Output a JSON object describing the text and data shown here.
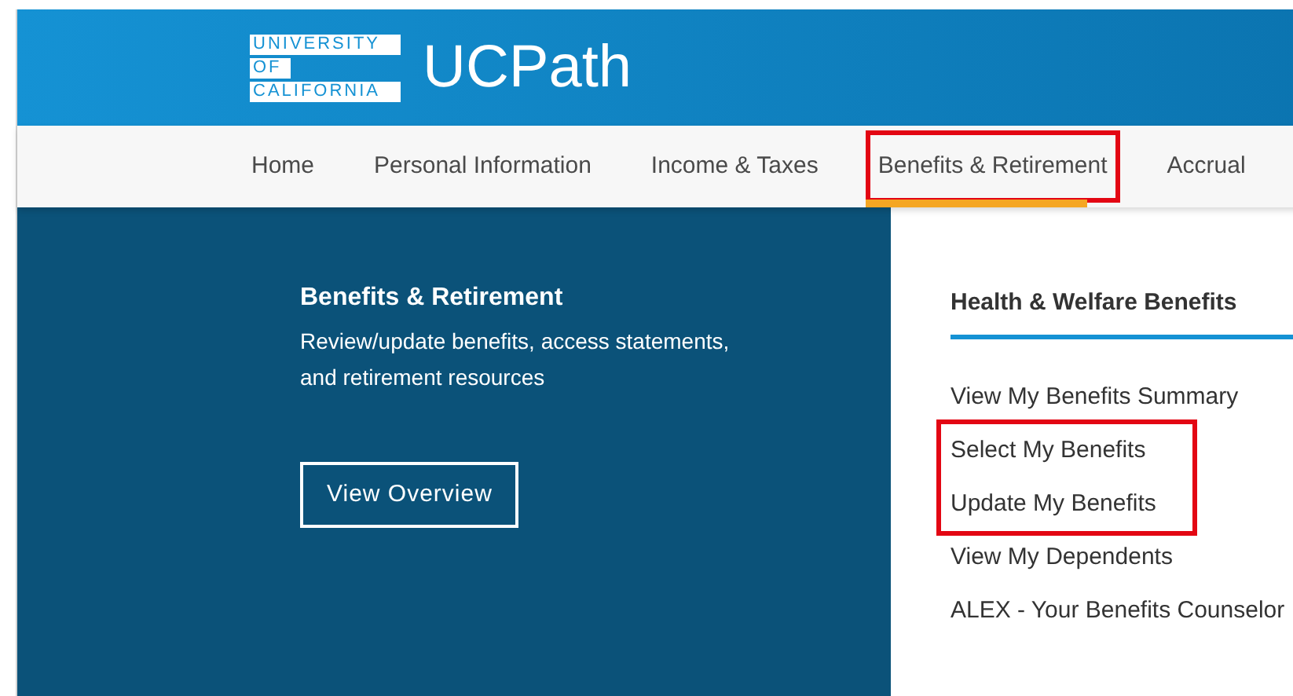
{
  "header": {
    "logo_lines": [
      "UNIVERSITY",
      "OF",
      "CALIFORNIA"
    ],
    "title": "UCPath"
  },
  "nav": [
    {
      "label": "Home",
      "selected": false,
      "highlighted": false
    },
    {
      "label": "Personal Information",
      "selected": false,
      "highlighted": false
    },
    {
      "label": "Income & Taxes",
      "selected": false,
      "highlighted": false
    },
    {
      "label": "Benefits & Retirement",
      "selected": true,
      "highlighted": true
    },
    {
      "label": "Accrual",
      "selected": false,
      "highlighted": false
    }
  ],
  "hero": {
    "title": "Benefits & Retirement",
    "description": "Review/update benefits, access statements, and retirement resources",
    "button": "View Overview"
  },
  "section": {
    "heading": "Health & Welfare Benefits",
    "links": [
      {
        "label": "View My Benefits Summary",
        "highlighted": false
      },
      {
        "label": "Select My Benefits",
        "highlighted": true
      },
      {
        "label": "Update My Benefits",
        "highlighted": true
      },
      {
        "label": "View My Dependents",
        "highlighted": false
      },
      {
        "label": "ALEX - Your Benefits Counselor",
        "highlighted": false
      }
    ]
  }
}
